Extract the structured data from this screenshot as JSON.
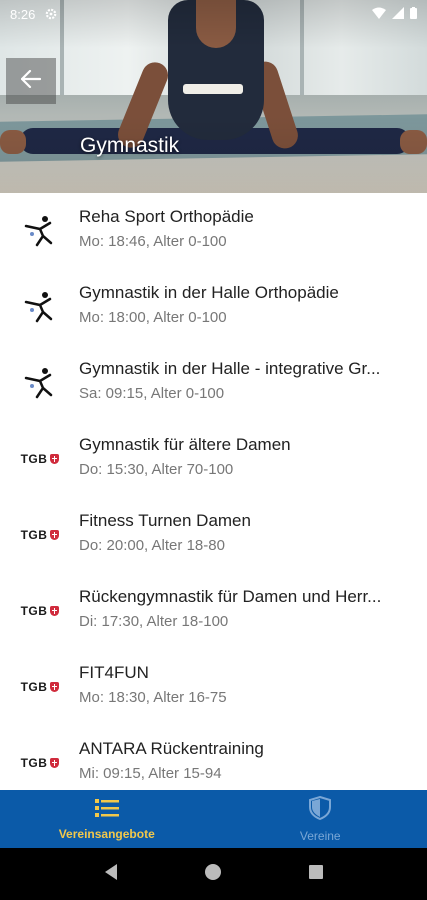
{
  "status_bar": {
    "time": "8:26"
  },
  "header": {
    "title": "Gymnastik"
  },
  "offers": [
    {
      "title": "Reha Sport Orthopädie",
      "subtitle": "Mo: 18:46, Alter 0-100",
      "logo": "gymnast-figure-icon"
    },
    {
      "title": "Gymnastik in der Halle Orthopädie",
      "subtitle": "Mo: 18:00, Alter 0-100",
      "logo": "gymnast-figure-icon"
    },
    {
      "title": "Gymnastik in der Halle - integrative Gr...",
      "subtitle": "Sa: 09:15, Alter 0-100",
      "logo": "gymnast-figure-icon"
    },
    {
      "title": "Gymnastik für ältere Damen",
      "subtitle": "Do: 15:30, Alter 70-100",
      "logo": "tgb-logo"
    },
    {
      "title": "Fitness Turnen Damen",
      "subtitle": "Do: 20:00, Alter 18-80",
      "logo": "tgb-logo"
    },
    {
      "title": "Rückengymnastik für Damen und Herr...",
      "subtitle": "Di: 17:30, Alter 18-100",
      "logo": "tgb-logo"
    },
    {
      "title": "FIT4FUN",
      "subtitle": "Mo: 18:30, Alter 16-75",
      "logo": "tgb-logo"
    },
    {
      "title": "ANTARA Rückentraining",
      "subtitle": "Mi: 09:15, Alter 15-94",
      "logo": "tgb-logo"
    }
  ],
  "tgb_logo_text": "TGB",
  "bottom_nav": {
    "items": [
      {
        "label": "Vereinsangebote",
        "icon": "list-icon",
        "active": true
      },
      {
        "label": "Vereine",
        "icon": "shield-icon",
        "active": false
      }
    ]
  },
  "colors": {
    "nav_bg": "#0b5aa8",
    "active": "#f2c84b",
    "inactive": "#7aa7d6"
  }
}
